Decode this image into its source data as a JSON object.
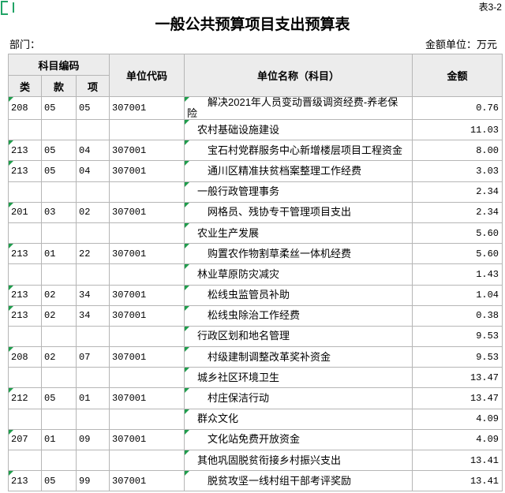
{
  "header": {
    "sheet_no": "表3-2",
    "title": "一般公共预算项目支出预算表",
    "department_label": "部门：",
    "unit_label": "金额单位：万元"
  },
  "columns": {
    "subject_code": "科目编码",
    "lei": "类",
    "kuan": "款",
    "xiang": "项",
    "unit_code": "单位代码",
    "unit_name": "单位名称（科目）",
    "amount": "金额"
  },
  "colors": {
    "error_marker": "#1f9d4c",
    "header_bg": "#ececec",
    "grid_line": "#b6b6b6"
  },
  "rows": [
    {
      "lei": "208",
      "kuan": "05",
      "xiang": "05",
      "unit_code": "307001",
      "name": "解决2021年人员变动晋级调资经费-养老保险",
      "amount": "0.76"
    },
    {
      "lei": "",
      "kuan": "",
      "xiang": "",
      "unit_code": "",
      "name": "农村基础设施建设",
      "amount": "11.03"
    },
    {
      "lei": "213",
      "kuan": "05",
      "xiang": "04",
      "unit_code": "307001",
      "name": "宝石村党群服务中心新增楼层项目工程资金",
      "amount": "8.00"
    },
    {
      "lei": "213",
      "kuan": "05",
      "xiang": "04",
      "unit_code": "307001",
      "name": "通川区精准扶贫档案整理工作经费",
      "amount": "3.03"
    },
    {
      "lei": "",
      "kuan": "",
      "xiang": "",
      "unit_code": "",
      "name": "一般行政管理事务",
      "amount": "2.34"
    },
    {
      "lei": "201",
      "kuan": "03",
      "xiang": "02",
      "unit_code": "307001",
      "name": "网格员、残协专干管理项目支出",
      "amount": "2.34"
    },
    {
      "lei": "",
      "kuan": "",
      "xiang": "",
      "unit_code": "",
      "name": "农业生产发展",
      "amount": "5.60"
    },
    {
      "lei": "213",
      "kuan": "01",
      "xiang": "22",
      "unit_code": "307001",
      "name": "购置农作物割草柔丝一体机经费",
      "amount": "5.60"
    },
    {
      "lei": "",
      "kuan": "",
      "xiang": "",
      "unit_code": "",
      "name": "林业草原防灾减灾",
      "amount": "1.43"
    },
    {
      "lei": "213",
      "kuan": "02",
      "xiang": "34",
      "unit_code": "307001",
      "name": "松线虫监管员补助",
      "amount": "1.04"
    },
    {
      "lei": "213",
      "kuan": "02",
      "xiang": "34",
      "unit_code": "307001",
      "name": "松线虫除治工作经费",
      "amount": "0.38"
    },
    {
      "lei": "",
      "kuan": "",
      "xiang": "",
      "unit_code": "",
      "name": "行政区划和地名管理",
      "amount": "9.53"
    },
    {
      "lei": "208",
      "kuan": "02",
      "xiang": "07",
      "unit_code": "307001",
      "name": "村级建制调整改革奖补资金",
      "amount": "9.53"
    },
    {
      "lei": "",
      "kuan": "",
      "xiang": "",
      "unit_code": "",
      "name": "城乡社区环境卫生",
      "amount": "13.47"
    },
    {
      "lei": "212",
      "kuan": "05",
      "xiang": "01",
      "unit_code": "307001",
      "name": "村庄保洁行动",
      "amount": "13.47"
    },
    {
      "lei": "",
      "kuan": "",
      "xiang": "",
      "unit_code": "",
      "name": "群众文化",
      "amount": "4.09"
    },
    {
      "lei": "207",
      "kuan": "01",
      "xiang": "09",
      "unit_code": "307001",
      "name": "文化站免费开放资金",
      "amount": "4.09"
    },
    {
      "lei": "",
      "kuan": "",
      "xiang": "",
      "unit_code": "",
      "name": "其他巩固脱贫衔接乡村振兴支出",
      "amount": "13.41"
    },
    {
      "lei": "213",
      "kuan": "05",
      "xiang": "99",
      "unit_code": "307001",
      "name": "脱贫攻坚一线村组干部考评奖励",
      "amount": "13.41"
    }
  ]
}
